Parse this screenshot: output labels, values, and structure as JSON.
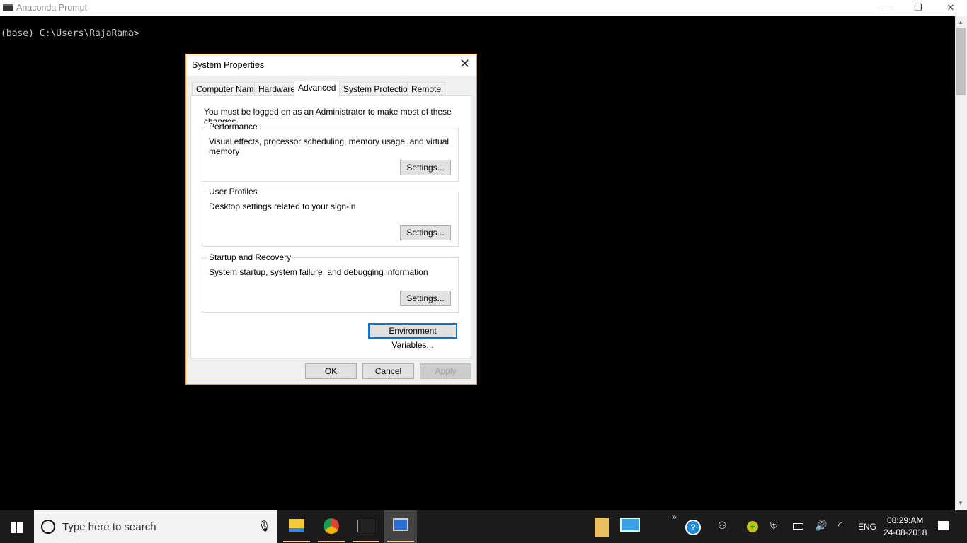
{
  "window": {
    "title": "Anaconda Prompt",
    "minimize": "—",
    "maximize": "❐",
    "close": "✕"
  },
  "console": {
    "prompt": "(base) C:\\Users\\RajaRama>"
  },
  "dialog": {
    "title": "System Properties",
    "tabs": [
      {
        "label": "Computer Name"
      },
      {
        "label": "Hardware"
      },
      {
        "label": "Advanced",
        "active": true
      },
      {
        "label": "System Protection"
      },
      {
        "label": "Remote"
      }
    ],
    "notice": "You must be logged on as an Administrator to make most of these changes.",
    "groups": [
      {
        "label": "Performance",
        "description": "Visual effects, processor scheduling, memory usage, and virtual memory",
        "button": "Settings..."
      },
      {
        "label": "User Profiles",
        "description": "Desktop settings related to your sign-in",
        "button": "Settings..."
      },
      {
        "label": "Startup and Recovery",
        "description": "System startup, system failure, and debugging information",
        "button": "Settings..."
      }
    ],
    "env_button": "Environment Variables...",
    "ok": "OK",
    "cancel": "Cancel",
    "apply": "Apply"
  },
  "taskbar": {
    "search_placeholder": "Type here to search",
    "apps": [
      "file-explorer",
      "chrome",
      "anaconda-prompt",
      "system-properties"
    ],
    "tray": {
      "overflow": "»",
      "language": "ENG",
      "time": "08:29:AM",
      "date": "24-08-2018"
    }
  },
  "colors": {
    "dialog_border": "#e49a3c",
    "focus": "#0078d7",
    "taskbar": "#1c1b1a"
  }
}
